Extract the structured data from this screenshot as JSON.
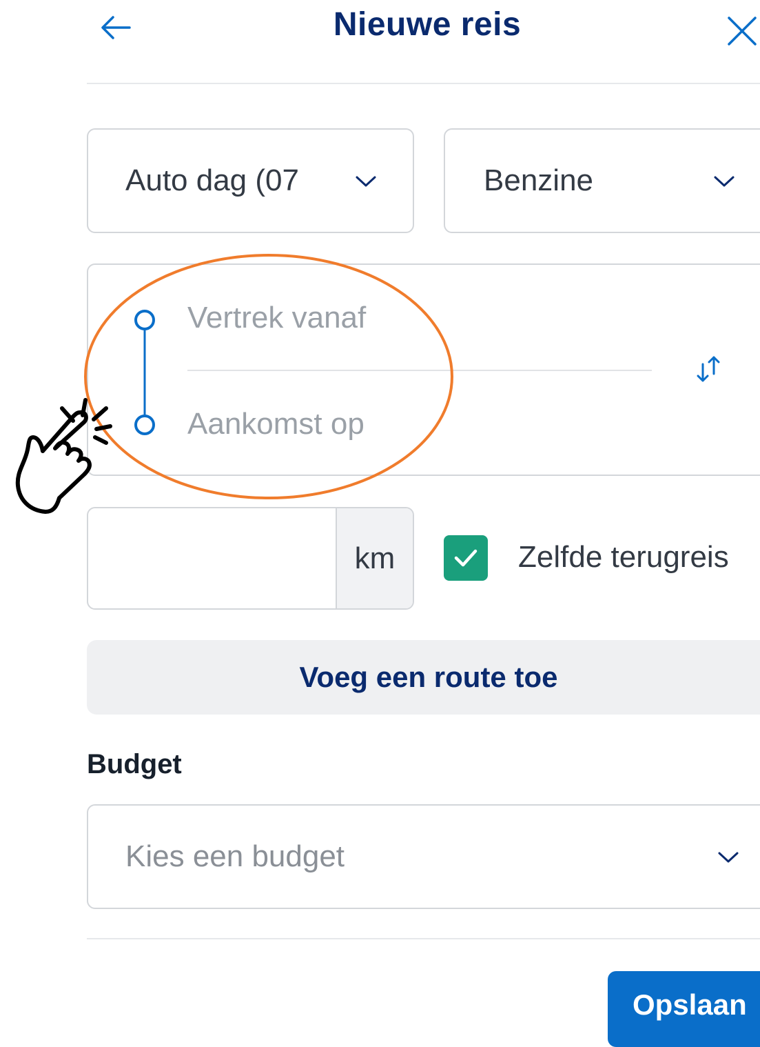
{
  "header": {
    "title": "Nieuwe reis",
    "back_icon": "arrow-left-icon",
    "close_icon": "close-icon"
  },
  "transport_select": {
    "value": "Auto dag (07"
  },
  "fuel_select": {
    "value": "Benzine"
  },
  "route": {
    "departure_placeholder": "Vertrek vanaf",
    "arrival_placeholder": "Aankomst op",
    "swap_icon": "swap-arrows-icon"
  },
  "distance": {
    "value": "",
    "unit": "km"
  },
  "return_trip": {
    "label": "Zelfde terugreis",
    "checked": true
  },
  "add_route_label": "Voeg een route toe",
  "budget": {
    "label": "Budget",
    "placeholder": "Kies een budget"
  },
  "save_label": "Opslaan",
  "annotations": {
    "highlight_icon": "orange-ellipse-highlight",
    "pointer_icon": "tap-hand-icon"
  },
  "colors": {
    "title": "#0a2a6e",
    "primary": "#0a6ec9",
    "route_line": "#0a6ec9",
    "checkbox": "#1a9f7c",
    "highlight": "#f07c2c"
  }
}
